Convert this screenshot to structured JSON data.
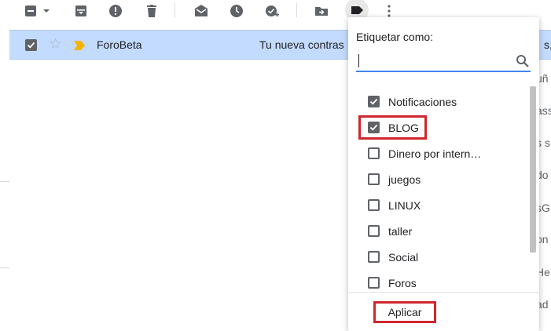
{
  "toolbar": {
    "icons": [
      "select-checkbox-icon",
      "archive-icon",
      "report-spam-icon",
      "delete-icon",
      "mark-unread-icon",
      "snooze-icon",
      "add-to-tasks-icon",
      "move-to-icon",
      "labels-icon",
      "more-icon"
    ]
  },
  "email_row": {
    "sender": "ForoBeta",
    "subject": "Tu nueva contras",
    "trailing": "s, S",
    "selected": true,
    "starred": false,
    "important_marker_color": "#f4b400"
  },
  "background_fragments": [
    "uñ",
    "ass",
    "s s",
    "do",
    "sG",
    "on",
    "He",
    "ad"
  ],
  "label_menu": {
    "title": "Etiquetar como:",
    "search_value": "",
    "labels": [
      {
        "name": "Notificaciones",
        "checked": true
      },
      {
        "name": "BLOG",
        "checked": true
      },
      {
        "name": "Dinero por intern…",
        "checked": false
      },
      {
        "name": "juegos",
        "checked": false
      },
      {
        "name": "LINUX",
        "checked": false
      },
      {
        "name": "taller",
        "checked": false
      },
      {
        "name": "Social",
        "checked": false
      },
      {
        "name": "Foros",
        "checked": false
      }
    ],
    "apply_label": "Aplicar"
  },
  "colors": {
    "selected_row": "#c2dbff",
    "search_underline": "#4285f4",
    "highlight_border": "#d0262e",
    "icon_gray": "#5f6368"
  }
}
